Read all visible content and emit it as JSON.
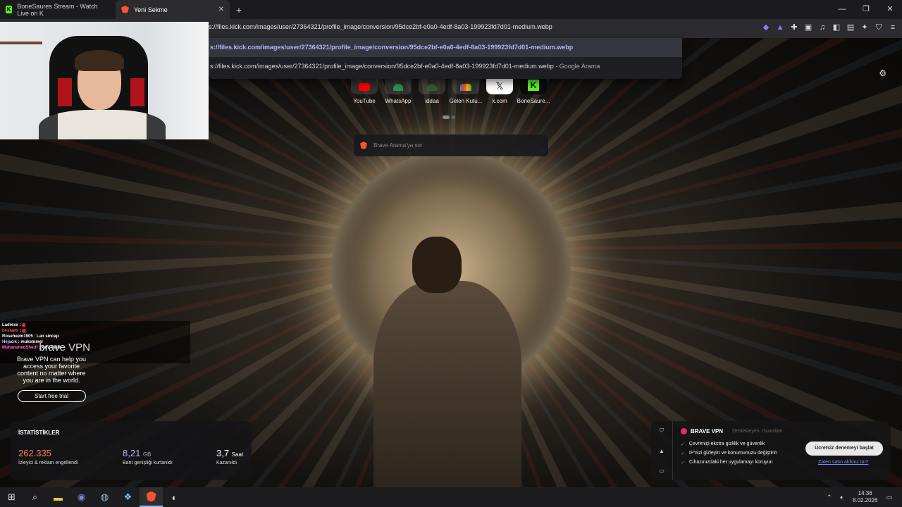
{
  "tabs": [
    {
      "label": "BoneSaures Stream - Watch Live on K",
      "icon": "kick-icon"
    },
    {
      "label": "Yeni Sekme",
      "icon": "brave-lion-icon"
    }
  ],
  "address": {
    "value": "s://files.kick.com/images/user/27364321/profile_image/conversion/95dce2bf-e0a0-4edf-8a03-199923fd7d01-medium.webp"
  },
  "suggestions": [
    {
      "text": "s://files.kick.com/images/user/27364321/profile_image/conversion/95dce2bf-e0a0-4edf-8a03-199923fd7d01-medium.webp",
      "suffix": ""
    },
    {
      "text": "s://files.kick.com/images/user/27364321/profile_image/conversion/95dce2bf-e0a0-4edf-8a03-199923fd7d01-medium.webp",
      "suffix": " - Google Arama"
    }
  ],
  "shortcuts": [
    {
      "label": "YouTube",
      "color": "#ff0000"
    },
    {
      "label": "WhatsApp",
      "color": "#25d366"
    },
    {
      "label": "iddaa",
      "color": "#2e7d32"
    },
    {
      "label": "Gelen Kutu...",
      "color": "#ea4335"
    },
    {
      "label": "x.com",
      "color": "#000000"
    },
    {
      "label": "BoneSaure...",
      "color": "#53fc18"
    }
  ],
  "search": {
    "placeholder": "Brave Arama'ya sor"
  },
  "chat": [
    {
      "user": "Ladrexx",
      "msg": ""
    },
    {
      "user": "bestaetr",
      "msg": ""
    },
    {
      "user": "Roseheem1905",
      "msg": "Lan sincap"
    },
    {
      "user": "Hejacik",
      "msg": "mukemmel"
    },
    {
      "user": "MuhammedSherif",
      "msg": "kara delik"
    }
  ],
  "promo": {
    "title": "brave VPN",
    "desc": "Brave VPN can help you access your favorite content no matter where you are in the world.",
    "button": "Start free trial"
  },
  "stats": {
    "title": "İSTATİSTİKLER",
    "items": [
      {
        "value": "262.335",
        "unit": "",
        "label": "İzleyici & reklam engellendi",
        "color": "#ff7a5c"
      },
      {
        "value": "8,21",
        "unit": "GB",
        "label": "Bant genişliği kurtarıldı",
        "color": "#b8b3ff"
      },
      {
        "value": "3,7",
        "unit": "Saat",
        "label": "Kazanıldı",
        "color": "#ffffff"
      }
    ]
  },
  "vpn": {
    "title": "BRAVE VPN",
    "sponsor": "Destekleyen: Guardian",
    "features": [
      "Çevrimiçi ekstra gizlilik ve güvenlik",
      "IP'nizi gizleyin ve konumunuzu değiştirin",
      "Cihazınızdaki her uygulamayı koruyun"
    ],
    "try": "Ücretsiz denemeyi başlat",
    "bought": "Zaten satın aldınız mı?"
  },
  "clock": {
    "time": "14:36",
    "date": "8.02.2026"
  }
}
